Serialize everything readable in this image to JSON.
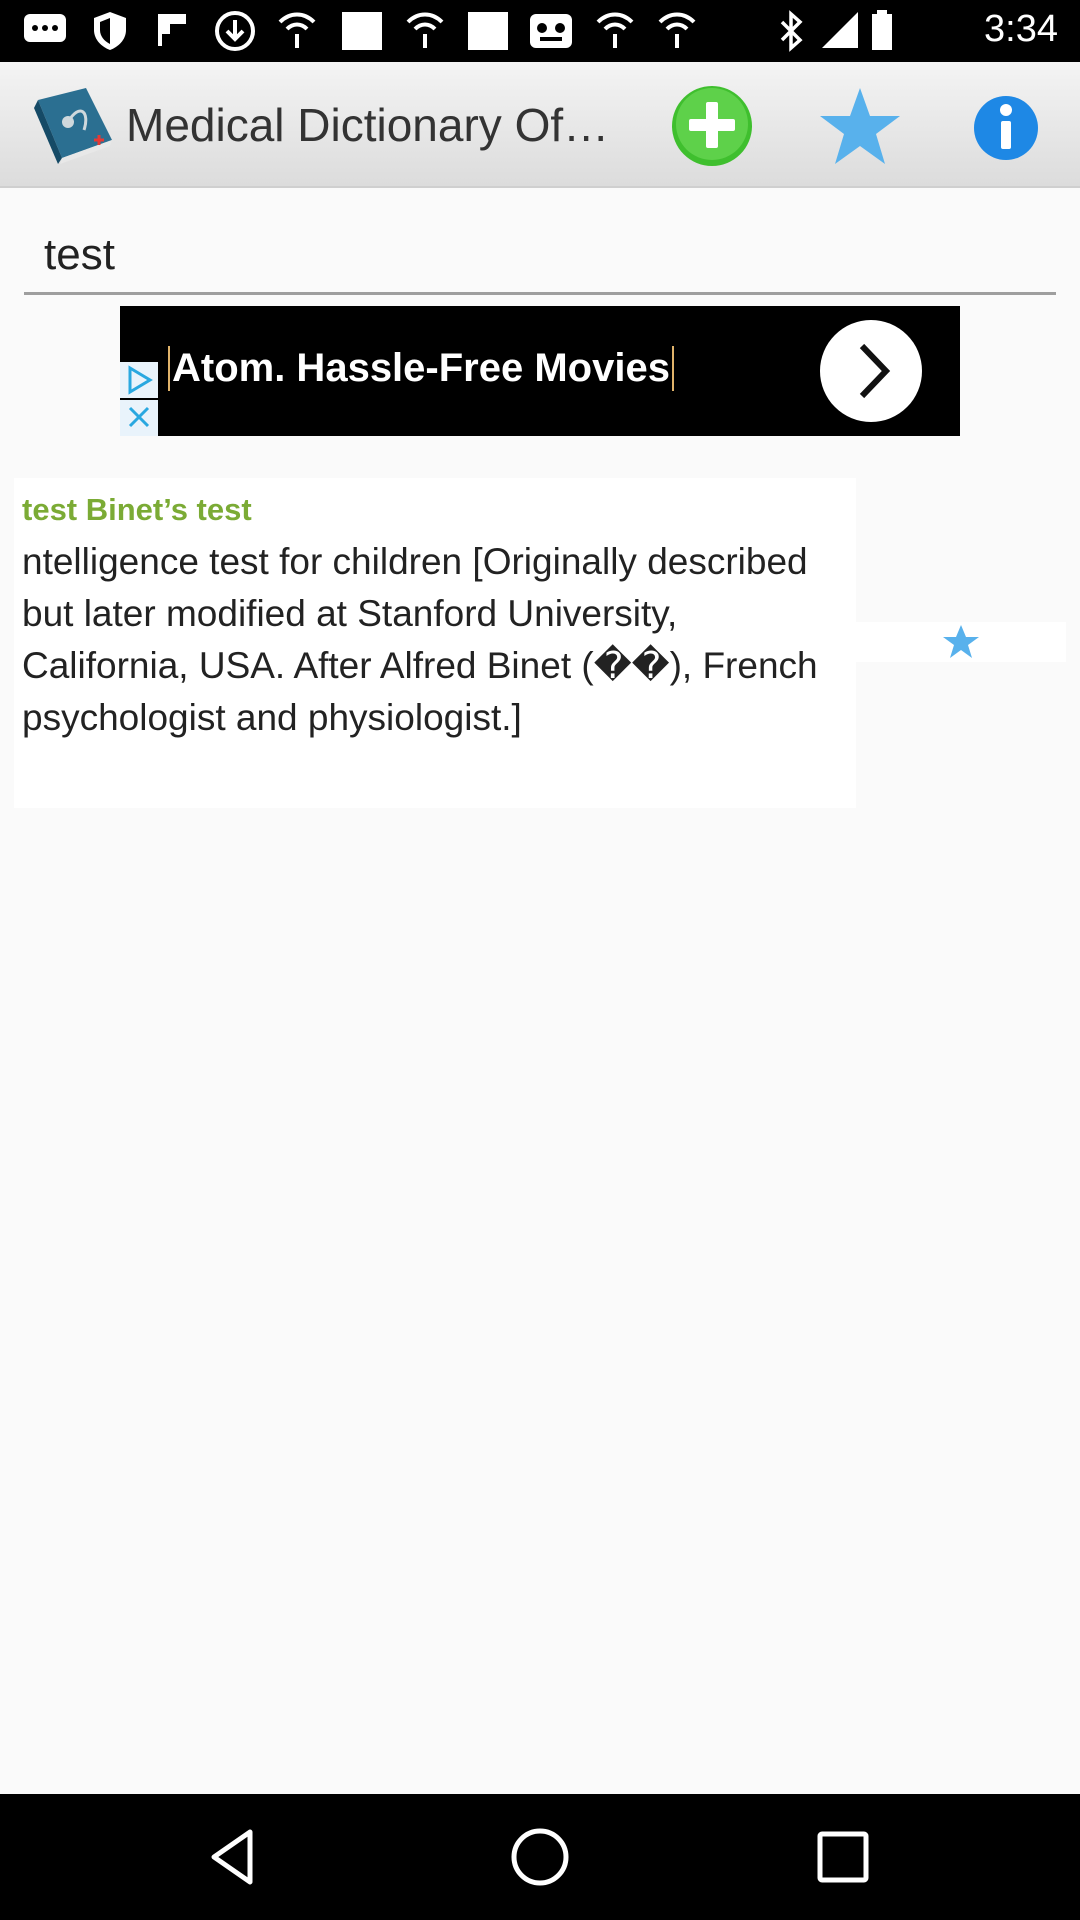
{
  "status_bar": {
    "time": "3:34",
    "left_icons": [
      "message-icon",
      "shield-icon",
      "flipboard-icon",
      "download-icon",
      "wifi-icon",
      "image-icon",
      "wifi-icon",
      "image-icon",
      "media-icon",
      "wifi-icon",
      "wifi-icon"
    ],
    "right_icons": [
      "bluetooth-icon",
      "signal-icon",
      "battery-icon"
    ]
  },
  "toolbar": {
    "title": "Medical Dictionary Of…",
    "add_icon": "plus-circle-icon",
    "favorites_icon": "star-icon",
    "info_icon": "info-icon",
    "colors": {
      "add": "#3fbf2e",
      "star": "#58b1ec",
      "info": "#1e88e5"
    }
  },
  "search": {
    "value": "test"
  },
  "ad": {
    "text": "Atom. Hassle-Free Movies",
    "go_icon": "chevron-right-icon",
    "choices_icon": "adchoices-icon",
    "close_icon": "close-icon"
  },
  "result": {
    "term": "test Binet’s test",
    "definition": "ntelligence test for children [Originally described but later modified at Stanford University, California, USA. After Alfred Binet (��), French psychologist and physiologist.]",
    "favorite_icon": "star-icon",
    "colors": {
      "term": "#7bab35",
      "star": "#58b1ec"
    }
  },
  "nav_bar": {
    "back_icon": "back-triangle-icon",
    "home_icon": "home-circle-icon",
    "recents_icon": "recents-square-icon"
  }
}
